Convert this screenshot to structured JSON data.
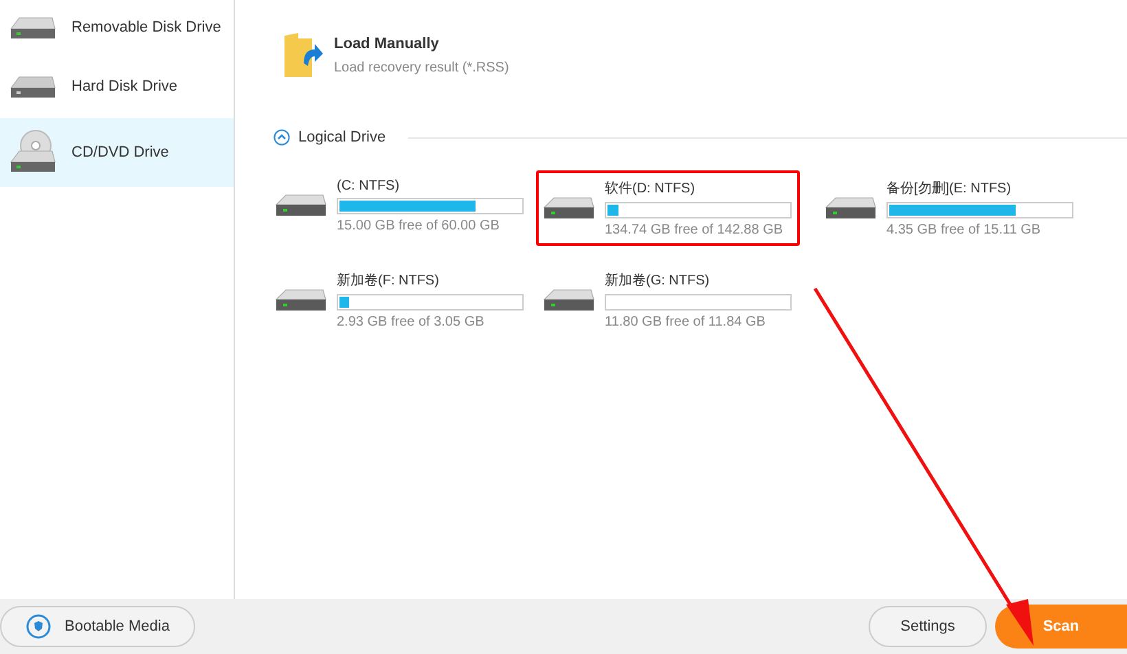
{
  "sidebar": {
    "items": [
      {
        "label": "Removable Disk Drive",
        "kind": "removable",
        "selected": false
      },
      {
        "label": "Hard Disk Drive",
        "kind": "hdd",
        "selected": false
      },
      {
        "label": "CD/DVD Drive",
        "kind": "optical",
        "selected": true
      }
    ]
  },
  "load_manually": {
    "title": "Load Manually",
    "subtitle": "Load recovery result (*.RSS)"
  },
  "logical_drive": {
    "title": "Logical Drive",
    "expanded": true,
    "drives": [
      {
        "name": "(C: NTFS)",
        "level": 0.75,
        "free": "15.00 GB free of 60.00 GB",
        "highlighted": false
      },
      {
        "name": "软件(D: NTFS)",
        "level": 0.06,
        "free": "134.74 GB free of 142.88 GB",
        "highlighted": true
      },
      {
        "name": "备份[勿删](E: NTFS)",
        "level": 0.7,
        "free": "4.35 GB free of 15.11 GB",
        "highlighted": false
      },
      {
        "name": "新加卷(F: NTFS)",
        "level": 0.05,
        "free": "2.93 GB free of 3.05 GB",
        "highlighted": false
      },
      {
        "name": "新加卷(G: NTFS)",
        "level": 0.0,
        "free": "11.80 GB free of 11.84 GB",
        "highlighted": false
      }
    ]
  },
  "footer": {
    "bootable_media": "Bootable Media",
    "settings": "Settings",
    "scan": "Scan"
  }
}
